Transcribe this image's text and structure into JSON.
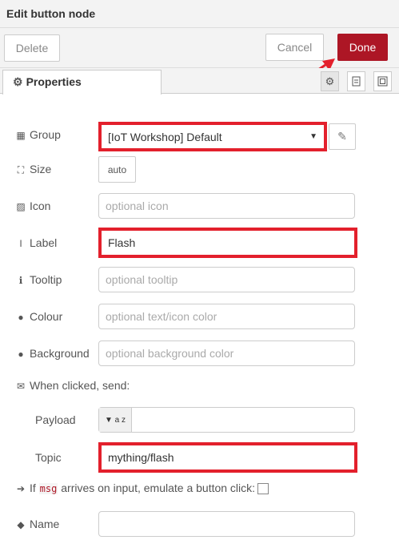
{
  "header": {
    "title": "Edit button node"
  },
  "toolbar": {
    "delete_label": "Delete",
    "cancel_label": "Cancel",
    "done_label": "Done"
  },
  "tabs": {
    "properties_label": "Properties"
  },
  "form": {
    "group": {
      "label": "Group",
      "value": "[IoT Workshop] Default"
    },
    "size": {
      "label": "Size",
      "value": "auto"
    },
    "icon": {
      "label": "Icon",
      "placeholder": "optional icon"
    },
    "label": {
      "label": "Label",
      "value": "Flash"
    },
    "tooltip": {
      "label": "Tooltip",
      "placeholder": "optional tooltip"
    },
    "colour": {
      "label": "Colour",
      "placeholder": "optional text/icon color"
    },
    "background": {
      "label": "Background",
      "placeholder": "optional background color"
    },
    "when_clicked": {
      "label": "When clicked, send:"
    },
    "payload": {
      "label": "Payload",
      "type_icon": "a z"
    },
    "topic": {
      "label": "Topic",
      "value": "mything/flash"
    },
    "emulate": {
      "prefix": "If",
      "code": "msg",
      "suffix": "arrives on input, emulate a button click:",
      "checked": false
    },
    "name": {
      "label": "Name",
      "value": ""
    }
  },
  "colors": {
    "accent": "#AD1625",
    "highlight": "#E3202C"
  },
  "icons": [
    "gear-icon",
    "file-icon",
    "frame-icon",
    "table-icon",
    "resize-icon",
    "image-icon",
    "text-cursor-icon",
    "info-icon",
    "drop-icon",
    "envelope-icon",
    "arrow-right-icon",
    "tag-icon",
    "pencil-icon",
    "caret-down-icon"
  ]
}
